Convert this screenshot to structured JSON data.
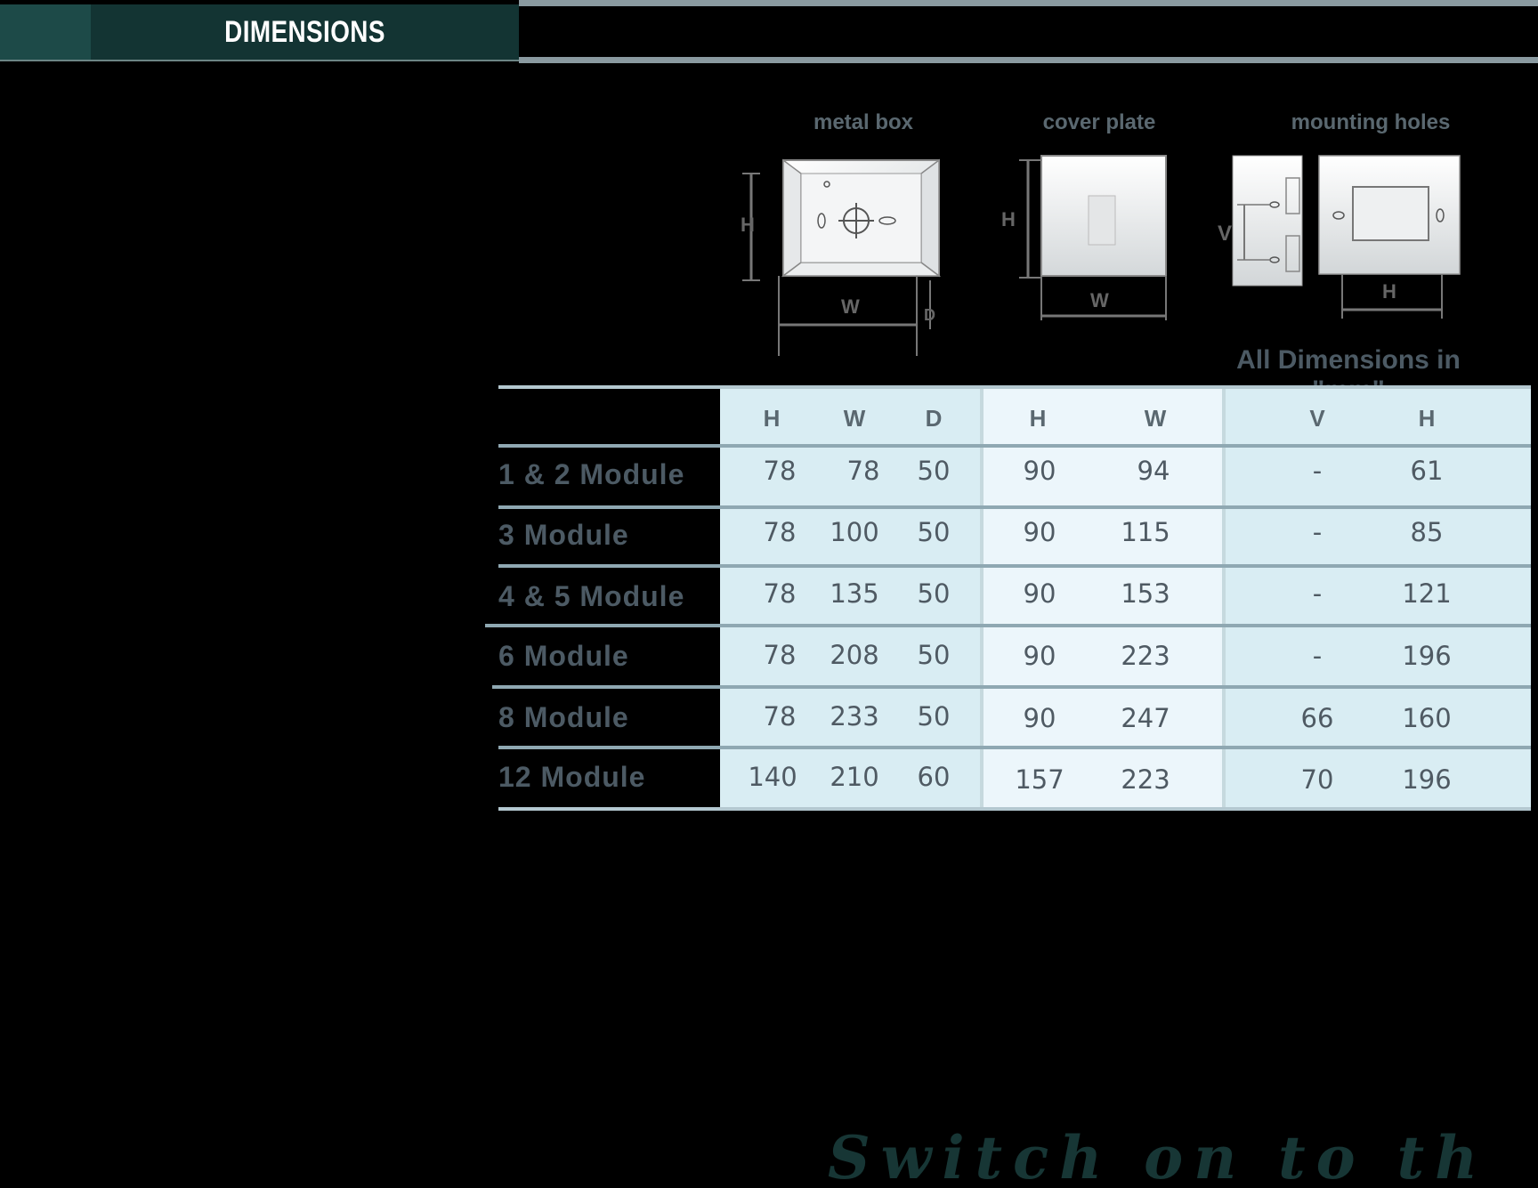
{
  "header": {
    "title": "DIMENSIONS"
  },
  "diagrams": {
    "labels": [
      "metal box",
      "cover plate",
      "mounting holes"
    ],
    "dimension_marks": {
      "h": "H",
      "w": "W",
      "d": "D",
      "v": "V"
    }
  },
  "unit_note": "All Dimensions in \"mm\"",
  "table": {
    "columns": [
      "H",
      "W",
      "D",
      "H",
      "W",
      "V",
      "H"
    ],
    "rows": [
      {
        "label": "1 & 2 Module",
        "values": [
          "78",
          "78",
          "50",
          "90",
          "94",
          "-",
          "61"
        ]
      },
      {
        "label": "3 Module",
        "values": [
          "78",
          "100",
          "50",
          "90",
          "115",
          "-",
          "85"
        ]
      },
      {
        "label": "4 & 5 Module",
        "values": [
          "78",
          "135",
          "50",
          "90",
          "153",
          "-",
          "121"
        ]
      },
      {
        "label": "6 Module",
        "values": [
          "78",
          "208",
          "50",
          "90",
          "223",
          "-",
          "196"
        ]
      },
      {
        "label": "8 Module",
        "values": [
          "78",
          "233",
          "50",
          "90",
          "247",
          "66",
          "160"
        ]
      },
      {
        "label": "12 Module",
        "values": [
          "140",
          "210",
          "60",
          "157",
          "223",
          "70",
          "196"
        ]
      }
    ]
  },
  "tagline": "Switch on to the Best..."
}
